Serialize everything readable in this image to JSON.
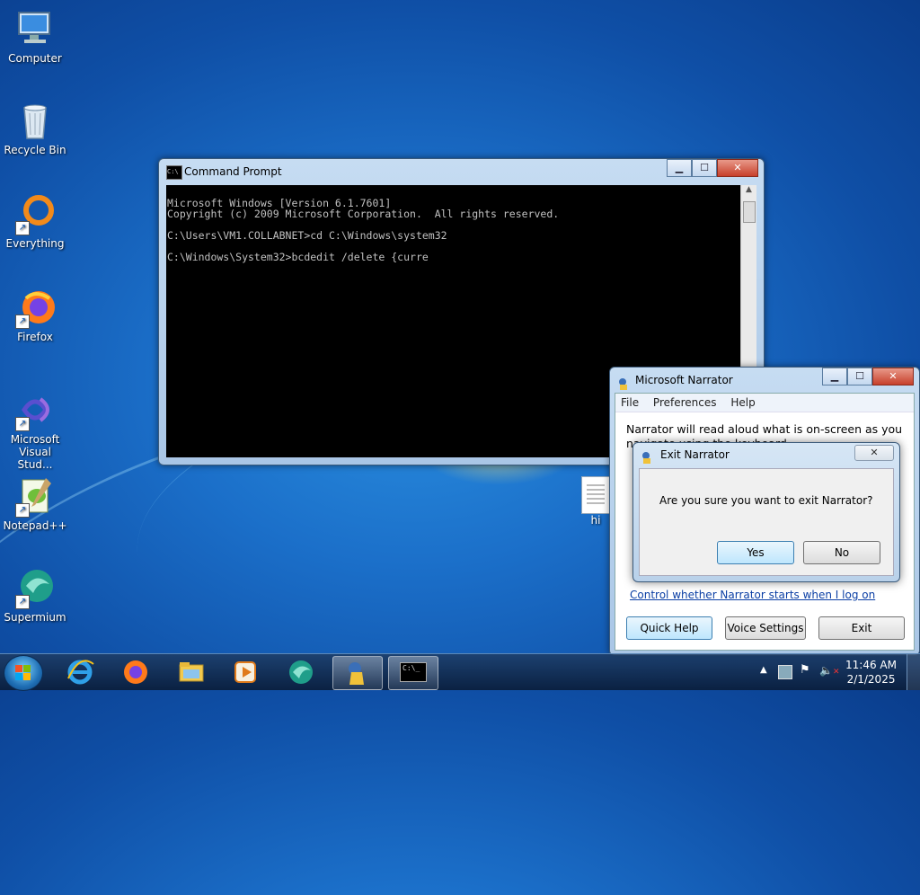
{
  "desktop": {
    "icons": [
      {
        "label": "Computer"
      },
      {
        "label": "Recycle Bin"
      },
      {
        "label": "Everything"
      },
      {
        "label": "Firefox"
      },
      {
        "label": "Microsoft Visual Stud..."
      },
      {
        "label": "Notepad++"
      },
      {
        "label": "Supermium"
      }
    ],
    "file_icon_label": "hi"
  },
  "cmd_window": {
    "title": "Command Prompt",
    "lines": [
      "Microsoft Windows [Version 6.1.7601]",
      "Copyright (c) 2009 Microsoft Corporation.  All rights reserved.",
      "",
      "C:\\Users\\VM1.COLLABNET>cd C:\\Windows\\system32",
      "",
      "C:\\Windows\\System32>bcdedit /delete {curre"
    ]
  },
  "narrator_window": {
    "title": "Microsoft Narrator",
    "menu": [
      "File",
      "Preferences",
      "Help"
    ],
    "description": "Narrator will read aloud what is on-screen as you navigate using the keyboard.",
    "link": "Control whether Narrator starts when I log on",
    "buttons": {
      "quick_help": "Quick Help",
      "voice_settings": "Voice Settings",
      "exit": "Exit"
    }
  },
  "exit_dialog": {
    "title": "Exit Narrator",
    "message": "Are you sure you want to exit Narrator?",
    "yes": "Yes",
    "no": "No",
    "close_glyph": "✕"
  },
  "taskbar": {
    "pinned": [
      "internet-explorer-icon",
      "firefox-icon",
      "file-explorer-icon",
      "media-player-icon",
      "supermium-icon",
      "narrator-icon",
      "command-prompt-icon"
    ],
    "time": "11:46 AM",
    "date": "2/1/2025"
  },
  "window_controls": {
    "minimize": "▁",
    "maximize": "☐",
    "close": "✕"
  }
}
